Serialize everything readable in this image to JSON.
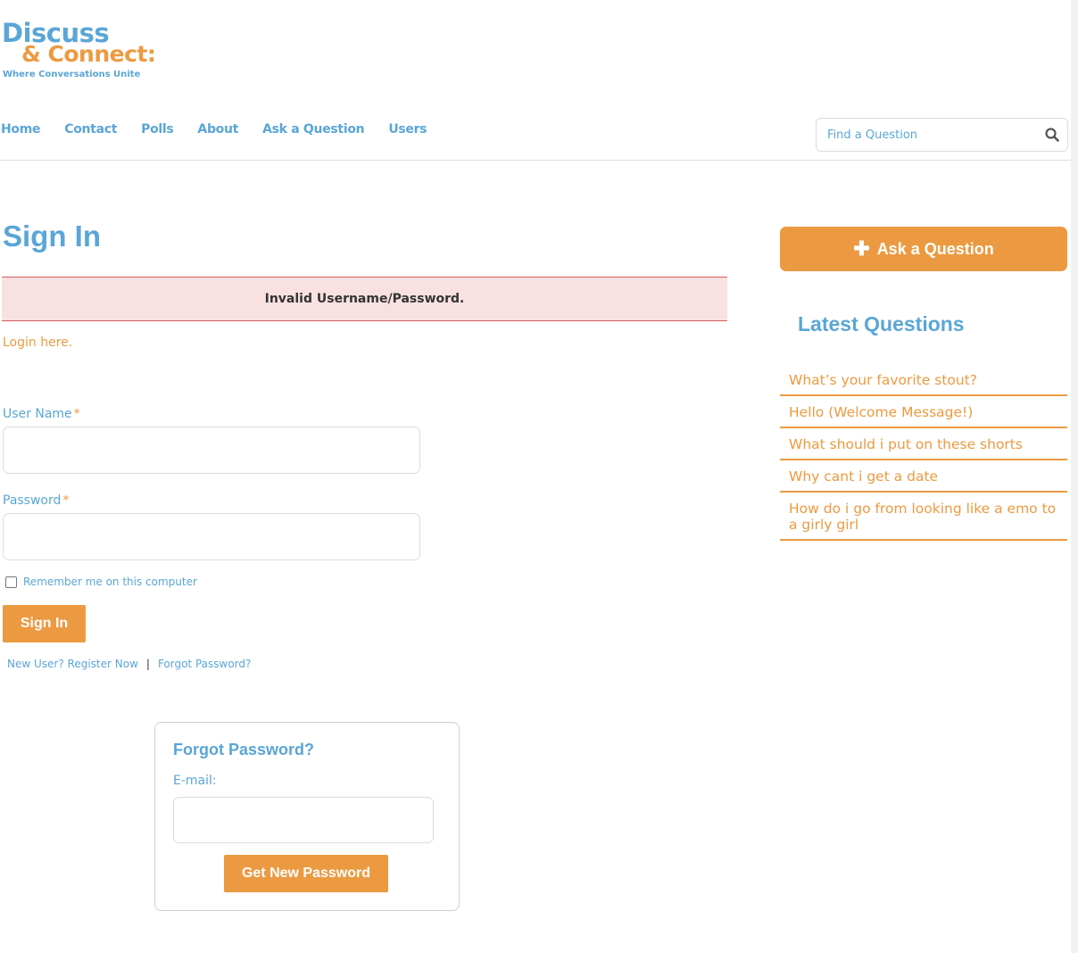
{
  "logo": {
    "line1": "Discuss",
    "line2": "& Connect:",
    "tagline": "Where Conversations Unite"
  },
  "nav": {
    "items": [
      "Home",
      "Contact",
      "Polls",
      "About",
      "Ask a Question",
      "Users"
    ]
  },
  "search": {
    "placeholder": "Find a Question",
    "icon": "search-icon"
  },
  "main": {
    "title": "Sign In",
    "alert": "Invalid Username/Password.",
    "login_link": "Login here.",
    "username_label": "User Name",
    "password_label": "Password",
    "required_mark": "*",
    "remember_label": "Remember me on this computer",
    "signin_button": "Sign In",
    "register_link": "New User? Register Now",
    "separator": "|",
    "forgot_link": "Forgot Password?"
  },
  "forgot_box": {
    "title": "Forgot Password?",
    "email_label": "E-mail:",
    "button": "Get New Password"
  },
  "sidebar": {
    "ask_button": "Ask a Question",
    "ask_icon": "plus-icon",
    "latest_title": "Latest Questions",
    "questions": [
      "What’s your favorite stout?",
      "Hello (Welcome Message!)",
      "What should i put on these shorts",
      "Why cant i get a date",
      "How do i go from looking like a emo to a girly girl"
    ]
  },
  "colors": {
    "blue": "#5aa6d6",
    "orange": "#ec9a41",
    "alert_bg": "#f9e1e1",
    "alert_border": "#d45a5a"
  }
}
